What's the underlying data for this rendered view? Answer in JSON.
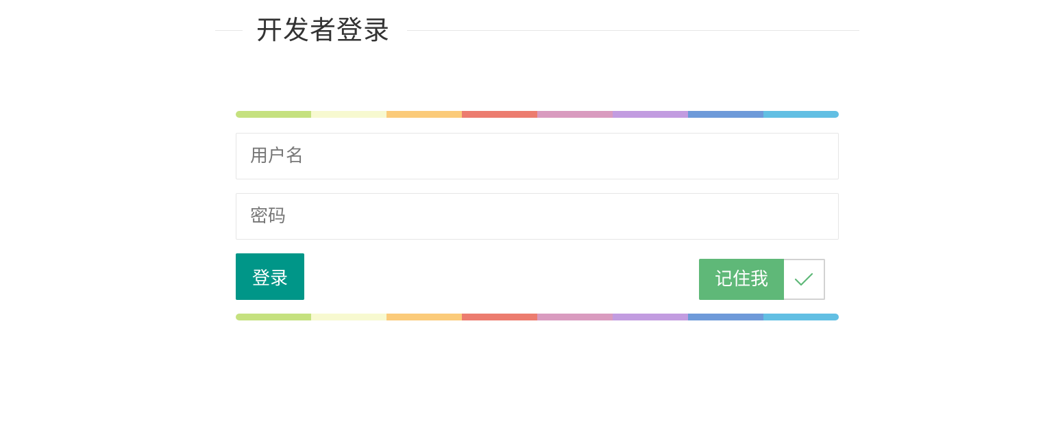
{
  "form": {
    "title": "开发者登录",
    "username_placeholder": "用户名",
    "password_placeholder": "密码",
    "login_label": "登录",
    "remember_label": "记住我",
    "remember_checked": true
  },
  "colors": {
    "primary": "#009688",
    "remember": "#5fb878",
    "rainbow": [
      "#c5e17f",
      "#f7f9d0",
      "#fbcb7a",
      "#ec7c6f",
      "#d99bbf",
      "#c29ce0",
      "#6e9ad9",
      "#62bfe3"
    ]
  },
  "icons": {
    "remember_check": "check-icon"
  }
}
